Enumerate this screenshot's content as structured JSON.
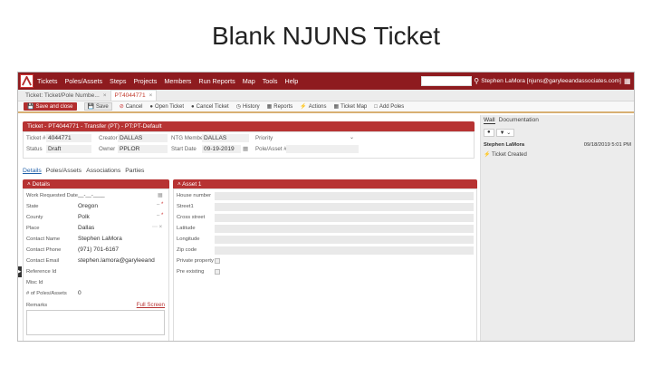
{
  "slide_title": "Blank NJUNS Ticket",
  "nav": {
    "items": [
      "Tickets",
      "Poles/Assets",
      "Steps",
      "Projects",
      "Members",
      "Run Reports",
      "Map",
      "Tools",
      "Help"
    ],
    "user": "Stephen LaMora [njuns@garyleeandassociates.com]"
  },
  "doc_tabs": [
    {
      "label": "Ticket: Ticket/Pole Numbe...",
      "close": "×"
    },
    {
      "label": "PT4044771",
      "close": "×"
    }
  ],
  "toolbar": {
    "save_close": "Save and close",
    "save": "Save",
    "cancel": "Cancel",
    "open_ticket": "Open Ticket",
    "cancel_ticket": "Cancel Ticket",
    "history": "History",
    "reports": "Reports",
    "actions": "Actions",
    "ticket_map": "Ticket Map",
    "add_poles": "Add Poles"
  },
  "ticket": {
    "header": "Ticket - PT4044771 - Transfer (PT) - PT:PT-Default",
    "ticket_label": "Ticket #",
    "ticket_value": "4044771",
    "creator_label": "Creator",
    "creator_value": "DALLAS",
    "ntg_label": "NTG Member",
    "ntg_value": "DALLAS",
    "priority_label": "Priority",
    "status_label": "Status",
    "status_value": "Draft",
    "owner_label": "Owner",
    "owner_value": "PPLOR",
    "start_label": "Start Date",
    "start_value": "09-19-2019",
    "pole_label": "Pole/Asset #"
  },
  "subtabs": [
    "Details",
    "Poles/Assets",
    "Associations",
    "Parties"
  ],
  "details": {
    "header": "Details",
    "rows": [
      {
        "label": "Work Requested Date",
        "value": "__-__-____"
      },
      {
        "label": "State",
        "value": "Oregon"
      },
      {
        "label": "County",
        "value": "Polk"
      },
      {
        "label": "Place",
        "value": "Dallas"
      },
      {
        "label": "Contact Name",
        "value": "Stephen LaMora"
      },
      {
        "label": "Contact Phone",
        "value": "(971) 701-6167"
      },
      {
        "label": "Contact Email",
        "value": "stephen.lamora@garyleeand"
      },
      {
        "label": "Reference Id",
        "value": ""
      },
      {
        "label": "Misc Id",
        "value": ""
      },
      {
        "label": "# of Poles/Assets",
        "value": "0"
      }
    ],
    "remarks_label": "Remarks",
    "full_screen": "Full Screen"
  },
  "asset": {
    "header": "Asset 1",
    "fields": [
      "House number",
      "Street1",
      "Cross street",
      "Latitude",
      "Longitude",
      "Zip code"
    ],
    "checks": [
      "Private property",
      "Pre existing"
    ]
  },
  "side": {
    "tabs": [
      "Wall",
      "Documentation"
    ],
    "author": "Stephen LaMora",
    "timestamp": "09/18/2019 5:01 PM",
    "entry": "Ticket Created"
  },
  "colors": {
    "brand": "#8e1b1f",
    "panel": "#b73333",
    "link": "#1f5fa8"
  }
}
